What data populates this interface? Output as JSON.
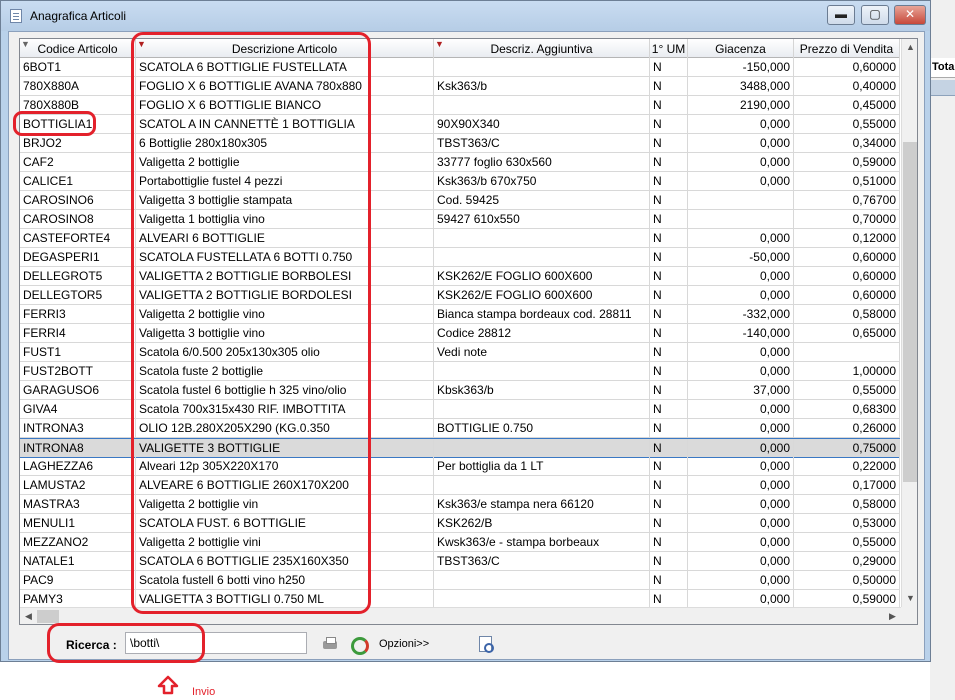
{
  "window": {
    "title": "Anagrafica Articoli",
    "controls": {
      "minimize": "▬",
      "maximize": "▢",
      "close": "✕"
    }
  },
  "background_app": {
    "column_label": "Tota"
  },
  "table": {
    "columns": [
      {
        "label": "Codice Articolo",
        "filtered": true
      },
      {
        "label": "Descrizione Articolo",
        "filtered": true
      },
      {
        "label": "Descriz. Aggiuntiva",
        "filtered": true
      },
      {
        "label": "1° UM",
        "filtered": false
      },
      {
        "label": "Giacenza",
        "filtered": false
      },
      {
        "label": "Prezzo di Vendita",
        "filtered": false
      }
    ],
    "rows": [
      [
        "6BOT1",
        "SCATOLA 6 BOTTIGLIE FUSTELLATA",
        "",
        "N",
        "-150,000",
        "0,60000"
      ],
      [
        "780X880A",
        "FOGLIO X 6 BOTTIGLIE AVANA 780x880",
        "Ksk363/b",
        "N",
        "3488,000",
        "0,40000"
      ],
      [
        "780X880B",
        "FOGLIO  X 6 BOTTIGLIE BIANCO",
        "",
        "N",
        "2190,000",
        "0,45000"
      ],
      [
        "BOTTIGLIA1",
        "SCATOL A IN CANNETTÈ 1 BOTTIGLIA",
        "90X90X340",
        "N",
        "0,000",
        "0,55000"
      ],
      [
        "BRJO2",
        "6 Bottiglie 280x180x305",
        "TBST363/C",
        "N",
        "0,000",
        "0,34000"
      ],
      [
        "CAF2",
        "Valigetta 2 bottiglie",
        "33777  foglio 630x560",
        "N",
        "0,000",
        "0,59000"
      ],
      [
        "CALICE1",
        "Portabottiglie fustel  4 pezzi",
        "Ksk363/b 670x750",
        "N",
        "0,000",
        "0,51000"
      ],
      [
        "CAROSINO6",
        "Valigetta 3 bottiglie stampata",
        "Cod. 59425",
        "N",
        "",
        "0,76700"
      ],
      [
        "CAROSINO8",
        "Valigetta 1 bottiglia vino",
        "59427   610x550",
        "N",
        "",
        "0,70000"
      ],
      [
        "CASTEFORTE4",
        "ALVEARI 6 BOTTIGLIE",
        "",
        "N",
        "0,000",
        "0,12000"
      ],
      [
        "DEGASPERI1",
        "SCATOLA FUSTELLATA 6 BOTTI 0.750",
        "",
        "N",
        "-50,000",
        "0,60000"
      ],
      [
        "DELLEGROT5",
        "VALIGETTA 2 BOTTIGLIE BORBOLESI",
        "KSK262/E  FOGLIO  600X600",
        "N",
        "0,000",
        "0,60000"
      ],
      [
        "DELLEGTOR5",
        "VALIGETTA 2 BOTTIGLIE BORDOLESI",
        "KSK262/E  FOGLIO 600X600",
        "N",
        "0,000",
        "0,60000"
      ],
      [
        "FERRI3",
        "Valigetta 2 bottiglie vino",
        "Bianca stampa bordeaux  cod. 28811",
        "N",
        "-332,000",
        "0,58000"
      ],
      [
        "FERRI4",
        "Valigetta 3 bottiglie vino",
        "Codice 28812",
        "N",
        "-140,000",
        "0,65000"
      ],
      [
        "FUST1",
        "Scatola 6/0.500 205x130x305  olio",
        "Vedi note",
        "N",
        "0,000",
        ""
      ],
      [
        "FUST2BOTT",
        "Scatola fuste 2 bottiglie",
        "",
        "N",
        "0,000",
        "1,00000"
      ],
      [
        "GARAGUSO6",
        "Scatola fustel 6 bottiglie h 325 vino/olio",
        "Kbsk363/b",
        "N",
        "37,000",
        "0,55000"
      ],
      [
        "GIVA4",
        "Scatola 700x315x430  RIF. IMBOTTITA",
        "",
        "N",
        "0,000",
        "0,68300"
      ],
      [
        "INTRONA3",
        "OLIO 12B.280X205X290 (KG.0.350",
        "BOTTIGLIE 0.750",
        "N",
        "0,000",
        "0,26000"
      ],
      [
        "INTRONA8",
        "VALIGETTE 3 BOTTIGLIE",
        "",
        "N",
        "0,000",
        "0,75000"
      ],
      [
        "LAGHEZZA6",
        "Alveari 12p  305X220X170",
        "Per bottiglia da 1 LT",
        "N",
        "0,000",
        "0,22000"
      ],
      [
        "LAMUSTA2",
        "ALVEARE 6 BOTTIGLIE 260X170X200",
        "",
        "N",
        "0,000",
        "0,17000"
      ],
      [
        "MASTRA3",
        "Valigetta 2 bottiglie  vin",
        "Ksk363/e stampa nera 66120",
        "N",
        "0,000",
        "0,58000"
      ],
      [
        "MENULI1",
        "SCATOLA FUST. 6 BOTTIGLIE",
        "KSK262/B",
        "N",
        "0,000",
        "0,53000"
      ],
      [
        "MEZZANO2",
        "Valigetta 2 bottiglie vini",
        "Kwsk363/e - stampa borbeaux",
        "N",
        "0,000",
        "0,55000"
      ],
      [
        "NATALE1",
        "SCATOLA 6 BOTTIGLIE 235X160X350",
        "TBST363/C",
        "N",
        "0,000",
        "0,29000"
      ],
      [
        "PAC9",
        "Scatola fustell 6 botti vino h250",
        "",
        "N",
        "0,000",
        "0,50000"
      ],
      [
        "PAMY3",
        "VALIGETTA 3 BOTTIGLI 0.750 ML",
        "",
        "N",
        "0,000",
        "0,59000"
      ]
    ],
    "selected_row_code": "INTRONA8",
    "scrollbar": {
      "up": "▲",
      "down": "▼",
      "left": "◀",
      "right": "▶"
    }
  },
  "search": {
    "label": "Ricerca :",
    "value": "\\botti\\",
    "options_label": "Opzioni>>"
  },
  "annotation": {
    "arrow_label": "Invio",
    "color": "#e3212b"
  }
}
